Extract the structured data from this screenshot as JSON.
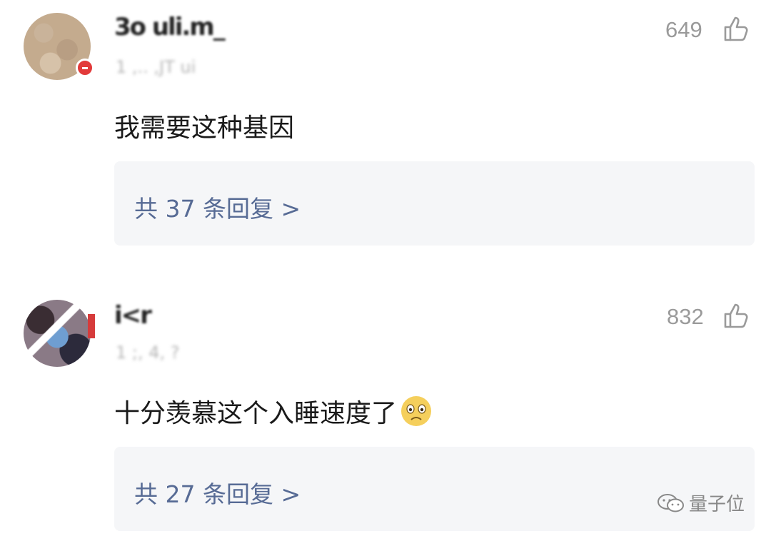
{
  "comments": [
    {
      "username": "3o uli.m_",
      "meta": "1 ,.. ,JT ui",
      "likes": "649",
      "text": "我需要这种基因",
      "replies_label": "共 37 条回复 >"
    },
    {
      "username": "i<r",
      "meta": "1 ;, 4, ?",
      "likes": "832",
      "text": "十分羡慕这个入睡速度了",
      "replies_label": "共 27 条回复 >"
    }
  ],
  "emoji": "worried-face-icon",
  "watermark": {
    "text": "量子位",
    "icon": "wechat-icon"
  },
  "colors": {
    "reply_link": "#576b95",
    "reply_bg": "#f5f6f8",
    "muted": "#9a9a9a"
  }
}
